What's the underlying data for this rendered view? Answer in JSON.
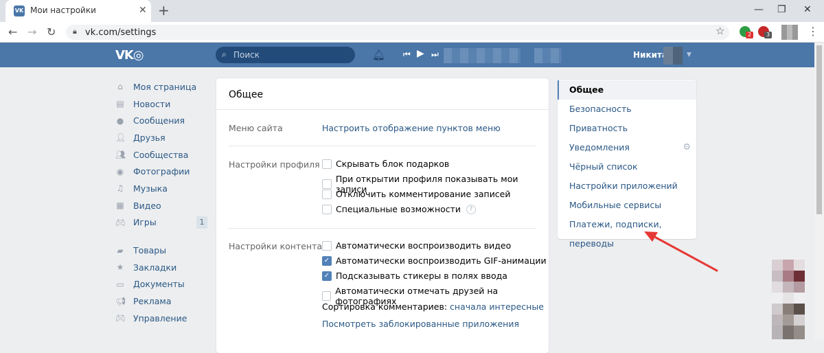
{
  "browser": {
    "tab_title": "Мои настройки",
    "tab_favicon": "VK",
    "url": "vk.com/settings",
    "ext_badges": [
      "2",
      "3"
    ]
  },
  "header": {
    "search_placeholder": "Поиск",
    "user_name": "Никита"
  },
  "left_nav": {
    "items": [
      {
        "label": "Моя страница",
        "icon": "home-icon"
      },
      {
        "label": "Новости",
        "icon": "news-icon"
      },
      {
        "label": "Сообщения",
        "icon": "messages-icon"
      },
      {
        "label": "Друзья",
        "icon": "friends-icon"
      },
      {
        "label": "Сообщества",
        "icon": "groups-icon"
      },
      {
        "label": "Фотографии",
        "icon": "camera-icon"
      },
      {
        "label": "Музыка",
        "icon": "music-icon"
      },
      {
        "label": "Видео",
        "icon": "video-icon"
      },
      {
        "label": "Игры",
        "icon": "games-icon",
        "badge": "1"
      }
    ],
    "items2": [
      {
        "label": "Товары",
        "icon": "bag-icon"
      },
      {
        "label": "Закладки",
        "icon": "star-icon"
      },
      {
        "label": "Документы",
        "icon": "document-icon"
      },
      {
        "label": "Реклама",
        "icon": "megaphone-icon"
      },
      {
        "label": "Управление",
        "icon": "gamepad-icon"
      }
    ]
  },
  "main": {
    "title": "Общее",
    "site_menu_label": "Меню сайта",
    "site_menu_link": "Настроить отображение пунктов меню",
    "profile_label": "Настройки профиля",
    "profile_options": [
      {
        "label": "Скрывать блок подарков",
        "checked": false
      },
      {
        "label": "При открытии профиля показывать мои записи",
        "checked": false
      },
      {
        "label": "Отключить комментирование записей",
        "checked": false
      },
      {
        "label": "Специальные возможности",
        "checked": false
      }
    ],
    "content_label": "Настройки контента",
    "content_options": [
      {
        "label": "Автоматически воспроизводить видео",
        "checked": false
      },
      {
        "label": "Автоматически воспроизводить GIF-анимации",
        "checked": true
      },
      {
        "label": "Подсказывать стикеры в полях ввода",
        "checked": true
      },
      {
        "label": "Автоматически отмечать друзей на фотографиях",
        "checked": false
      }
    ],
    "sort_label": "Сортировка комментариев:",
    "sort_value": "сначала интересные",
    "blocked_apps_link": "Посмотреть заблокированные приложения"
  },
  "right_menu": {
    "items": [
      {
        "label": "Общее",
        "active": true
      },
      {
        "label": "Безопасность"
      },
      {
        "label": "Приватность"
      },
      {
        "label": "Уведомления"
      },
      {
        "label": "Чёрный список"
      },
      {
        "label": "Настройки приложений"
      },
      {
        "label": "Мобильные сервисы"
      },
      {
        "label": "Платежи, подписки, переводы"
      }
    ]
  },
  "colors": {
    "vk_blue": "#4a76a8",
    "link": "#2a5885",
    "arrow": "#e53935"
  }
}
